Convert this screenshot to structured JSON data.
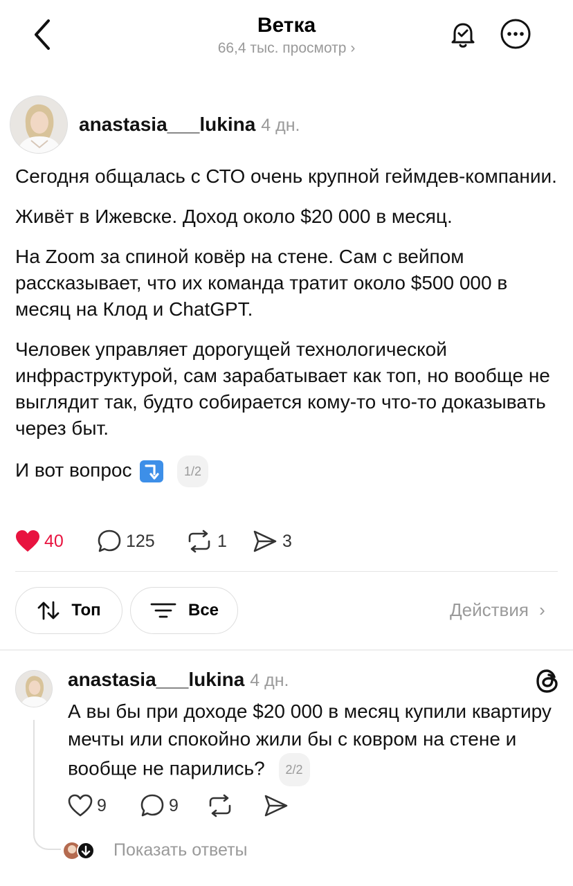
{
  "header": {
    "title": "Ветка",
    "views": "66,4 тыс. просмотр"
  },
  "post": {
    "username": "anastasia___lukina",
    "time": "4 дн.",
    "paragraphs": [
      "Сегодня общалась с СТО очень крупной геймдев-компании.",
      "Живёт в Ижевске. Доход около $20 000 в месяц.",
      "На Zoom за спиной ковёр на стене. Сам с вейпом рассказывает, что их команда тратит около $500 000 в месяц на Клод и ChatGPT.",
      "Человек управляет дорогущей технологической инфраструктурой, сам зарабатывает как топ, но вообще не выглядит так, будто собирается кому-то что-то доказывать через быт."
    ],
    "last_line": "И вот вопрос",
    "page_counter": "1/2",
    "likes": "40",
    "comments": "125",
    "reposts": "1",
    "shares": "3",
    "colors": {
      "like": "#e8133f"
    }
  },
  "filters": {
    "top_label": "Топ",
    "all_label": "Все",
    "actions_label": "Действия"
  },
  "reply": {
    "username": "anastasia___lukina",
    "time": "4 дн.",
    "text": "А вы бы при доходе $20 000 в месяц купили квартиру мечты или спокойно жили бы с ковром на стене и вообще не парились?",
    "page_counter": "2/2",
    "likes": "9",
    "comments": "9",
    "show_replies": "Показать ответы"
  }
}
